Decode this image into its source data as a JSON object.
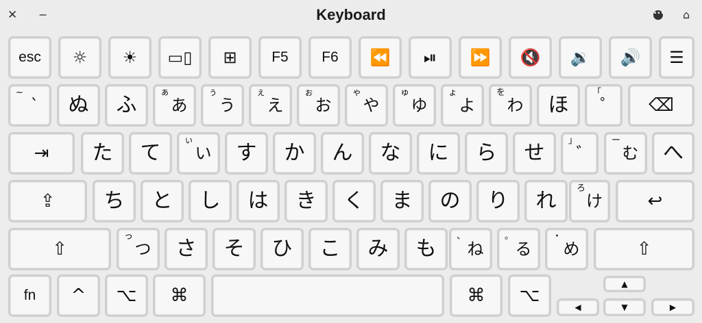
{
  "title": "Keyboard",
  "titlebar": {
    "close_glyph": "✕",
    "minimize_glyph": "−",
    "more_glyph": "•••",
    "home_glyph": "⌂"
  },
  "keys": {
    "esc": {
      "label": "esc"
    },
    "brightness_down": {
      "label": "☼"
    },
    "brightness_up": {
      "label": "☀"
    },
    "mission_control": {
      "label": "▭▯"
    },
    "launchpad": {
      "label": "⊞"
    },
    "f5": {
      "label": "F5"
    },
    "f6": {
      "label": "F6"
    },
    "rewind": {
      "label": "⏪"
    },
    "play_pause": {
      "label": "⏯"
    },
    "fast_forward": {
      "label": "⏩"
    },
    "mute": {
      "label": "🔇"
    },
    "volume_down": {
      "label": "🔉"
    },
    "volume_up": {
      "label": "🔊"
    },
    "list": {
      "label": "☰"
    },
    "backtick": {
      "sub": "~",
      "label": "`"
    },
    "nu": {
      "label": "ぬ"
    },
    "fu": {
      "label": "ふ"
    },
    "a": {
      "sub": "ぁ",
      "label": "あ"
    },
    "u": {
      "sub": "ぅ",
      "label": "う"
    },
    "e": {
      "sub": "ぇ",
      "label": "え"
    },
    "o": {
      "sub": "ぉ",
      "label": "お"
    },
    "ya": {
      "sub": "ゃ",
      "label": "や"
    },
    "yu": {
      "sub": "ゅ",
      "label": "ゆ"
    },
    "yo": {
      "sub": "ょ",
      "label": "よ"
    },
    "wa": {
      "sub": "を",
      "label": "わ"
    },
    "ho": {
      "label": "ほ"
    },
    "kagi_open": {
      "sub": "「",
      "label": "゜"
    },
    "delete": {
      "label": "⌫"
    },
    "tab": {
      "label": "⇥"
    },
    "ta": {
      "label": "た"
    },
    "te": {
      "label": "て"
    },
    "i": {
      "sub": "ぃ",
      "label": "い"
    },
    "su": {
      "label": "す"
    },
    "ka": {
      "label": "か"
    },
    "n": {
      "label": "ん"
    },
    "na": {
      "label": "な"
    },
    "ni": {
      "label": "に"
    },
    "ra": {
      "label": "ら"
    },
    "se": {
      "label": "せ"
    },
    "kagi_close": {
      "sub": "」",
      "label": "゛"
    },
    "mu": {
      "sub": "ー",
      "label": "む"
    },
    "he": {
      "label": "へ"
    },
    "caps": {
      "label": "⇪"
    },
    "chi": {
      "label": "ち"
    },
    "to": {
      "label": "と"
    },
    "shi": {
      "label": "し"
    },
    "ha": {
      "label": "は"
    },
    "ki": {
      "label": "き"
    },
    "ku": {
      "label": "く"
    },
    "ma": {
      "label": "ま"
    },
    "no": {
      "label": "の"
    },
    "ri": {
      "label": "り"
    },
    "re": {
      "label": "れ"
    },
    "ke": {
      "sub": "ろ",
      "label": "け"
    },
    "return": {
      "label": "↩"
    },
    "shift_left": {
      "label": "⇧"
    },
    "tsu": {
      "sub": "っ",
      "label": "つ"
    },
    "sa": {
      "label": "さ"
    },
    "so": {
      "label": "そ"
    },
    "hi": {
      "label": "ひ"
    },
    "ko": {
      "label": "こ"
    },
    "mi": {
      "label": "み"
    },
    "mo": {
      "label": "も"
    },
    "ne": {
      "sub": "、",
      "label": "ね"
    },
    "ru": {
      "sub": "。",
      "label": "る"
    },
    "me": {
      "sub": "・",
      "label": "め"
    },
    "shift_right": {
      "label": "⇧"
    },
    "fn": {
      "label": "fn"
    },
    "control": {
      "label": "^"
    },
    "option_left": {
      "label": "⌥"
    },
    "command_left": {
      "label": "⌘"
    },
    "space": {
      "label": ""
    },
    "command_right": {
      "label": "⌘"
    },
    "option_right": {
      "label": "⌥"
    },
    "arrow_up": {
      "label": "▲"
    },
    "arrow_left": {
      "label": "◀"
    },
    "arrow_down": {
      "label": "▼"
    },
    "arrow_right": {
      "label": "▶"
    }
  }
}
